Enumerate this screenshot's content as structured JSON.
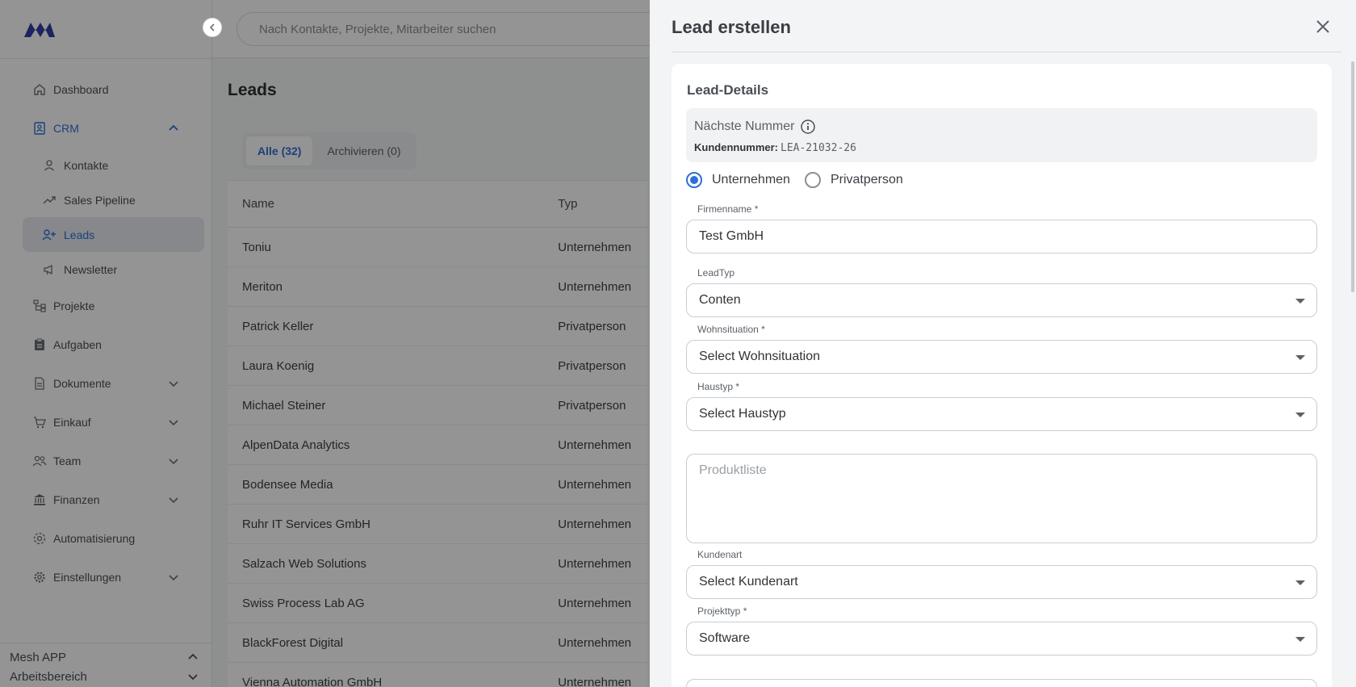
{
  "sidebar": {
    "logo_icon": "mesh-logo",
    "items": [
      {
        "label": "Dashboard",
        "icon": "home-icon"
      },
      {
        "label": "CRM",
        "icon": "contacts-book-icon"
      },
      {
        "label": "Projekte",
        "icon": "hierarchy-icon"
      },
      {
        "label": "Aufgaben",
        "icon": "clipboard-icon"
      },
      {
        "label": "Dokumente",
        "icon": "document-icon"
      },
      {
        "label": "Einkauf",
        "icon": "cart-icon"
      },
      {
        "label": "Team",
        "icon": "people-icon"
      },
      {
        "label": "Finanzen",
        "icon": "bank-icon"
      },
      {
        "label": "Automatisierung",
        "icon": "automation-icon"
      },
      {
        "label": "Einstellungen",
        "icon": "gear-icon"
      }
    ],
    "crm_sub": [
      {
        "label": "Kontakte",
        "icon": "user-icon"
      },
      {
        "label": "Sales Pipeline",
        "icon": "trend-icon"
      },
      {
        "label": "Leads",
        "icon": "user-plus-icon"
      },
      {
        "label": "Newsletter",
        "icon": "megaphone-icon"
      }
    ],
    "bottom": {
      "app": "Mesh APP",
      "workspace": "Arbeitsbereich"
    }
  },
  "search": {
    "placeholder": "Nach Kontakte, Projekte, Mitarbeiter suchen"
  },
  "page": {
    "title": "Leads"
  },
  "tabs": [
    {
      "label": "Alle (32)"
    },
    {
      "label": "Archivieren (0)"
    }
  ],
  "table": {
    "columns": [
      "Name",
      "Typ"
    ],
    "rows": [
      {
        "name": "Toniu",
        "typ": "Unternehmen"
      },
      {
        "name": "Meriton",
        "typ": "Unternehmen"
      },
      {
        "name": "Patrick Keller",
        "typ": "Privatperson"
      },
      {
        "name": "Laura Koenig",
        "typ": "Privatperson"
      },
      {
        "name": "Michael Steiner",
        "typ": "Privatperson"
      },
      {
        "name": "AlpenData Analytics",
        "typ": "Unternehmen"
      },
      {
        "name": "Bodensee Media",
        "typ": "Unternehmen"
      },
      {
        "name": "Ruhr IT Services GmbH",
        "typ": "Unternehmen"
      },
      {
        "name": "Salzach Web Solutions",
        "typ": "Unternehmen"
      },
      {
        "name": "Swiss Process Lab AG",
        "typ": "Unternehmen"
      },
      {
        "name": "BlackForest Digital",
        "typ": "Unternehmen"
      },
      {
        "name": "Vienna Automation GmbH",
        "typ": "Unternehmen"
      }
    ]
  },
  "drawer": {
    "title": "Lead erstellen",
    "section": "Lead-Details",
    "next_number_label": "Nächste Nummer",
    "customer_number_label": "Kundennummer:",
    "customer_number": "LEA-21032-26",
    "radio_company": "Unternehmen",
    "radio_private": "Privatperson",
    "fields": {
      "firmenname": {
        "label": "Firmenname *",
        "value": "Test GmbH"
      },
      "leadtyp": {
        "label": "LeadTyp",
        "value": "Conten"
      },
      "wohnsituation": {
        "label": "Wohnsituation *",
        "value": "Select Wohnsituation"
      },
      "haustyp": {
        "label": "Haustyp *",
        "value": "Select Haustyp"
      },
      "produktliste": {
        "placeholder": "Produktliste"
      },
      "kundenart": {
        "label": "Kundenart",
        "value": "Select Kundenart"
      },
      "projekttyp": {
        "label": "Projekttyp *",
        "value": "Software"
      }
    }
  },
  "colors": {
    "accent": "#2f6fd6",
    "overlay": "rgba(0,0,0,0.42)"
  }
}
